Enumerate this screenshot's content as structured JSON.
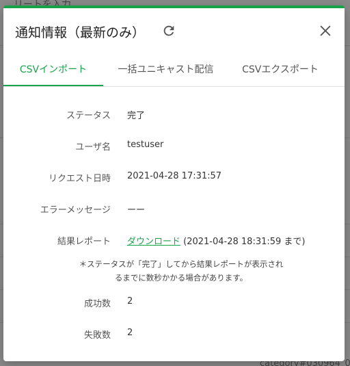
{
  "background": {
    "top_fragment": "リートを入力",
    "bottom_fragment": "category#030964_0"
  },
  "dialog": {
    "title": "通知情報（最新のみ）",
    "refresh_icon": "refresh-icon",
    "close_icon": "close-icon"
  },
  "tabs": [
    {
      "label": "CSVインポート",
      "active": true
    },
    {
      "label": "一括ユニキャスト配信",
      "active": false
    },
    {
      "label": "CSVエクスポート",
      "active": false
    }
  ],
  "details": {
    "status_label": "ステータス",
    "status_value": "完了",
    "user_label": "ユーザ名",
    "user_value": "testuser",
    "requested_label": "リクエスト日時",
    "requested_value": "2021-04-28 17:31:57",
    "error_label": "エラーメッセージ",
    "error_value": "ーー",
    "report_label": "結果レポート",
    "report_link": "ダウンロード",
    "report_note": "(2021-04-28 18:31:59 まで)",
    "note_line1": "＊ステータスが「完了」してから結果レポートが表示され",
    "note_line2": "るまでに数秒かかる場合があります。",
    "success_label": "成功数",
    "success_value": "2",
    "failure_label": "失敗数",
    "failure_value": "2"
  },
  "colors": {
    "accent": "#17a34a"
  }
}
